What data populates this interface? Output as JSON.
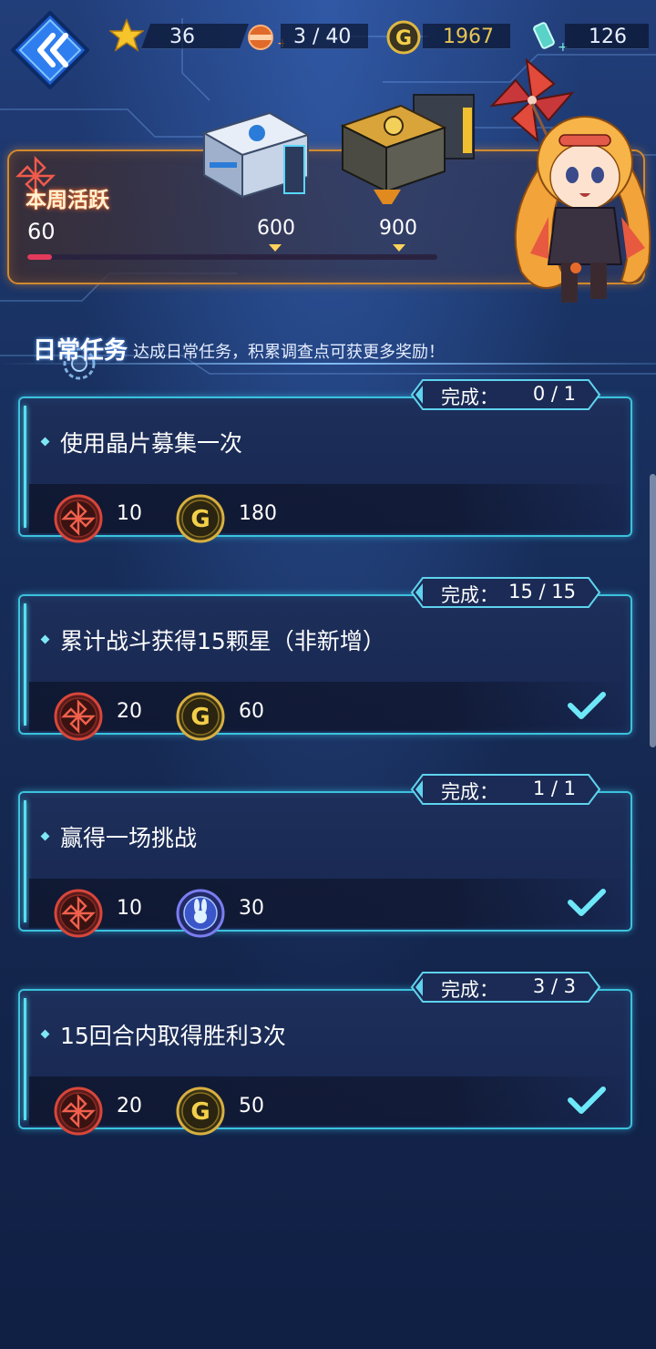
{
  "resources": {
    "stars": "36",
    "stamina": "3 / 40",
    "gold": "1967",
    "crystal": "126"
  },
  "weekly": {
    "title": "本周活跃",
    "current": "60",
    "milestones": [
      "600",
      "900"
    ],
    "progress_fraction": 0.06
  },
  "daily": {
    "title": "日常任务",
    "subtitle": "达成日常任务，积累调查点可获更多奖励！"
  },
  "tasks": [
    {
      "status_label": "完成：",
      "count": "0 / 1",
      "name": "使用晶片募集一次",
      "rewards": [
        {
          "icon": "pinwheel-icon",
          "value": "10"
        },
        {
          "icon": "gold-coin-icon",
          "value": "180"
        }
      ],
      "done": false
    },
    {
      "status_label": "完成：",
      "count": "15 / 15",
      "name": "累计战斗获得15颗星（非新增）",
      "rewards": [
        {
          "icon": "pinwheel-icon",
          "value": "20"
        },
        {
          "icon": "gold-coin-icon",
          "value": "60"
        }
      ],
      "done": true
    },
    {
      "status_label": "完成：",
      "count": "1 / 1",
      "name": "赢得一场挑战",
      "rewards": [
        {
          "icon": "pinwheel-icon",
          "value": "10"
        },
        {
          "icon": "rabbit-emblem-icon",
          "value": "30"
        }
      ],
      "done": true
    },
    {
      "status_label": "完成：",
      "count": "3 / 3",
      "name": "15回合内取得胜利3次",
      "rewards": [
        {
          "icon": "pinwheel-icon",
          "value": "20"
        },
        {
          "icon": "gold-coin-icon",
          "value": "50"
        }
      ],
      "done": true
    }
  ],
  "colors": {
    "card_border": "#3bc2dd",
    "weekly_border": "#d08a2e",
    "progress": "#e33a5b",
    "gold_text": "#e8c454",
    "check": "#6ee8f8"
  }
}
